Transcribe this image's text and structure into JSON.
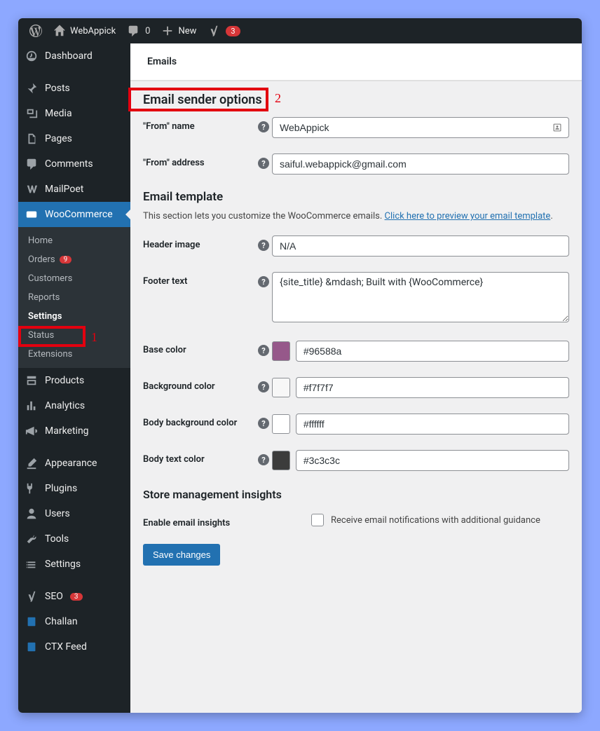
{
  "adminbar": {
    "site_name": "WebAppick",
    "comments_count": "0",
    "new_label": "New",
    "yoast_count": "3"
  },
  "sidebar": {
    "dashboard": "Dashboard",
    "posts": "Posts",
    "media": "Media",
    "pages": "Pages",
    "comments": "Comments",
    "mailpoet": "MailPoet",
    "woocommerce": "WooCommerce",
    "sub": {
      "home": "Home",
      "orders": "Orders",
      "orders_badge": "9",
      "customers": "Customers",
      "reports": "Reports",
      "settings": "Settings",
      "status": "Status",
      "extensions": "Extensions"
    },
    "products": "Products",
    "analytics": "Analytics",
    "marketing": "Marketing",
    "appearance": "Appearance",
    "plugins": "Plugins",
    "users": "Users",
    "tools": "Tools",
    "settings": "Settings",
    "seo": "SEO",
    "seo_badge": "3",
    "challan": "Challan",
    "ctx_feed": "CTX Feed"
  },
  "tabs": {
    "emails": "Emails"
  },
  "section1": {
    "title": "Email sender options",
    "from_name_label": "\"From\" name",
    "from_name_value": "WebAppick",
    "from_address_label": "\"From\" address",
    "from_address_value": "saiful.webappick@gmail.com"
  },
  "template": {
    "title": "Email template",
    "desc_pre": "This section lets you customize the WooCommerce emails. ",
    "desc_link": "Click here to preview your email template",
    "header_image_label": "Header image",
    "header_image_value": "N/A",
    "footer_text_label": "Footer text",
    "footer_text_value": "{site_title} &mdash; Built with {WooCommerce}",
    "base_color_label": "Base color",
    "base_color_value": "#96588a",
    "bg_color_label": "Background color",
    "bg_color_value": "#f7f7f7",
    "body_bg_label": "Body background color",
    "body_bg_value": "#ffffff",
    "body_text_label": "Body text color",
    "body_text_value": "#3c3c3c"
  },
  "insights": {
    "title": "Store management insights",
    "enable_label": "Enable email insights",
    "checkbox_label": "Receive email notifications with additional guidance"
  },
  "save_label": "Save changes",
  "annotations": {
    "num1": "1",
    "num2": "2"
  }
}
